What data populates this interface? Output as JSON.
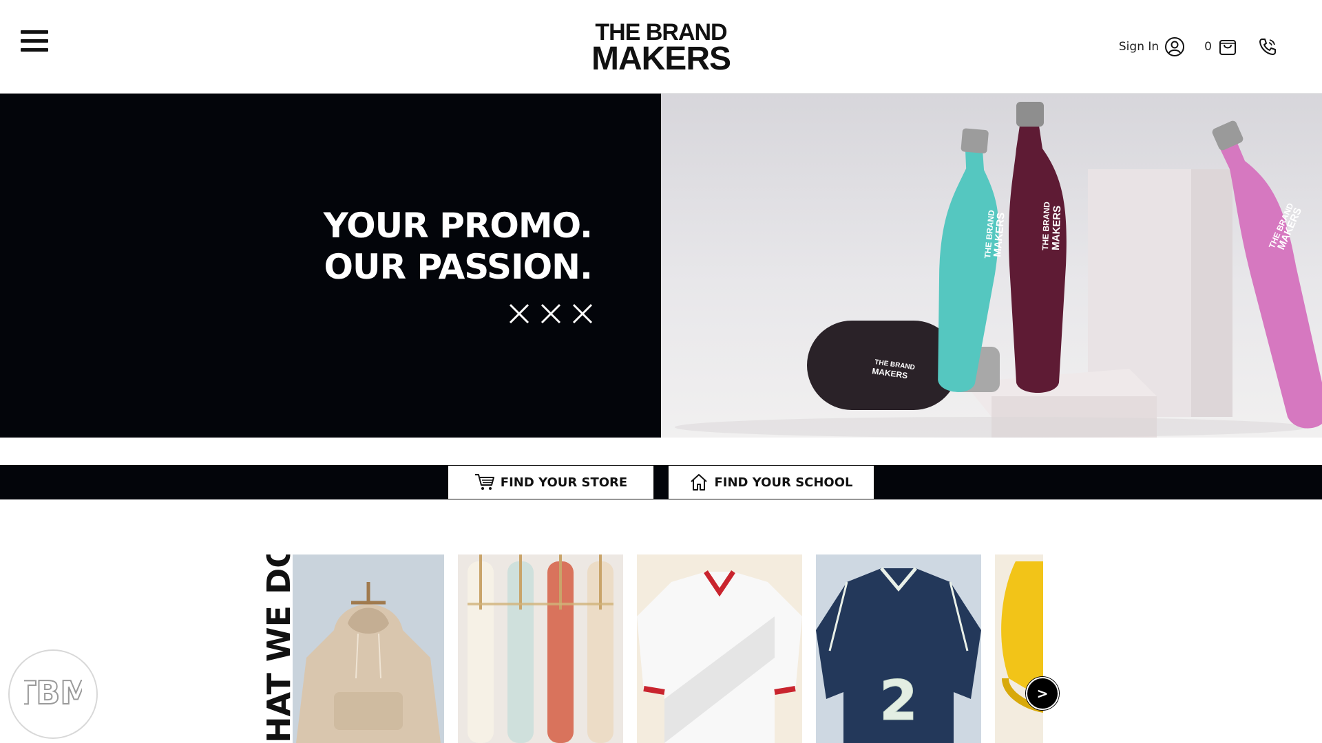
{
  "header": {
    "menu_icon": "hamburger-icon",
    "logo_line1": "THE BRAND",
    "logo_line2": "MAKERS",
    "sign_in_label": "Sign In",
    "account_icon": "user-circle-icon",
    "cart_count": "0",
    "cart_icon": "shopping-bag-icon",
    "phone_icon": "phone-icon"
  },
  "hero": {
    "headline_line1": "YOUR PROMO.",
    "headline_line2": "OUR PASSION.",
    "decor_icon": "x-marks-icon",
    "image_brand_text_line1": "THE BRAND",
    "image_brand_text_line2": "MAKERS"
  },
  "find_bar": {
    "store_label": "FIND YOUR STORE",
    "store_icon": "cart-icon",
    "school_label": "FIND YOUR SCHOOL",
    "school_icon": "house-icon"
  },
  "what_we_do": {
    "label": "HAT WE DO",
    "cards": [
      {
        "subject": "hoodie"
      },
      {
        "subject": "pens"
      },
      {
        "subject": "white-red-jersey"
      },
      {
        "subject": "navy-jersey",
        "number": "2"
      },
      {
        "subject": "yellow-hard-hat"
      }
    ],
    "next_label": ">"
  },
  "floating_badge": {
    "monogram": "TBM"
  },
  "colors": {
    "black": "#03050a",
    "white": "#ffffff"
  }
}
